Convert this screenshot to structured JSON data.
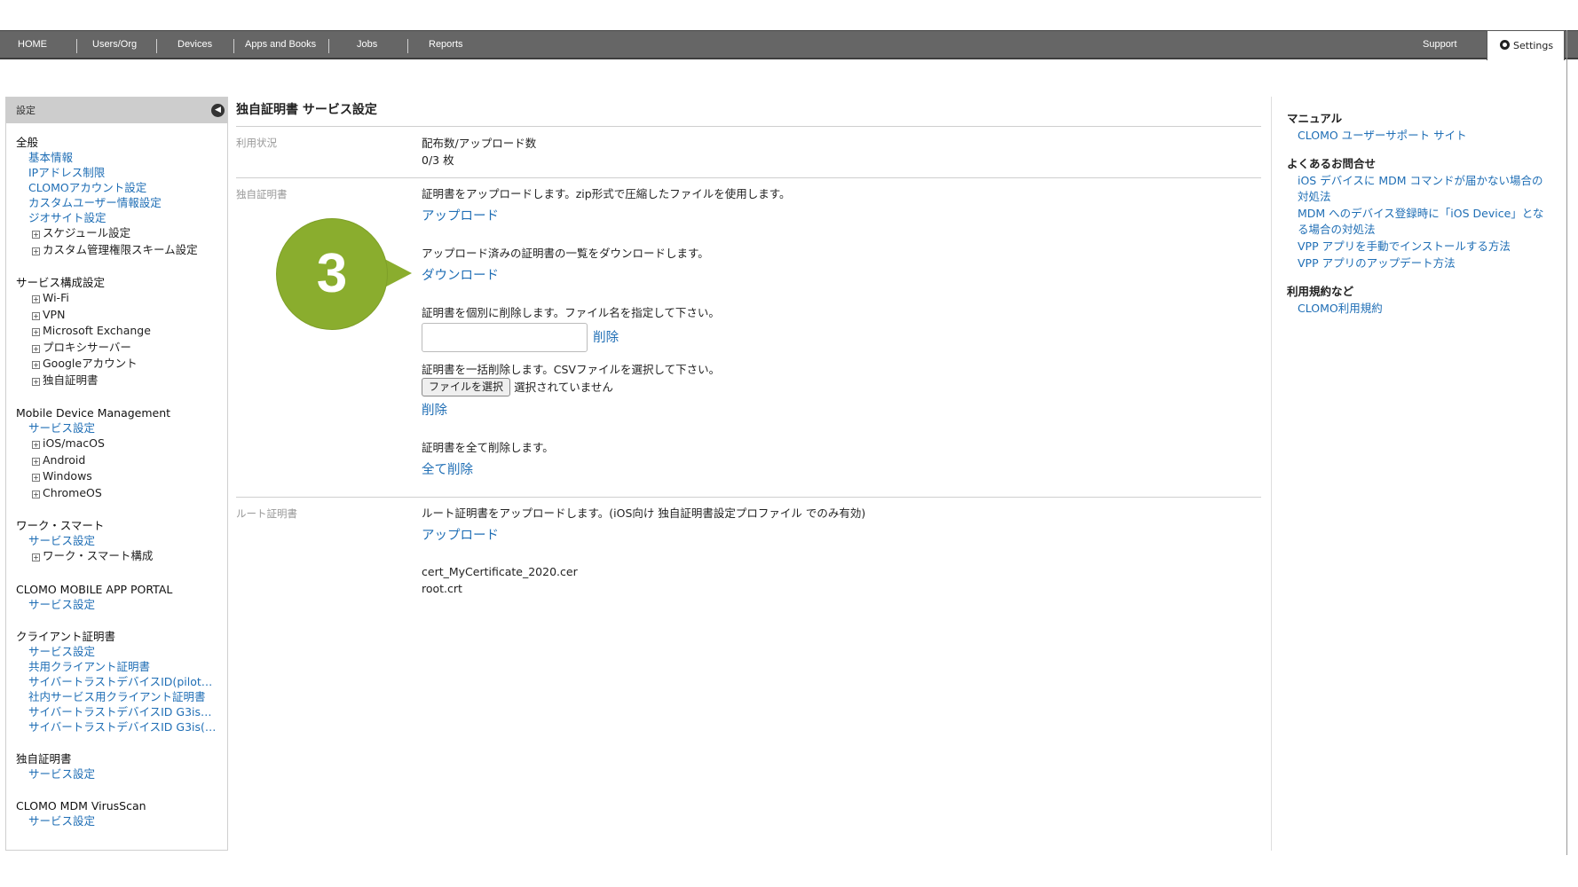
{
  "nav": {
    "items": [
      "HOME",
      "Users/Org",
      "Devices",
      "Apps and Books",
      "Jobs",
      "Reports"
    ],
    "support": "Support",
    "settings": "Settings"
  },
  "sidebar": {
    "header": "設定",
    "groups": [
      {
        "title": "全般",
        "links": [
          "基本情報",
          "IPアドレス制限",
          "CLOMOアカウント設定",
          "カスタムユーザー情報設定",
          "ジオサイト設定"
        ],
        "tree": [
          "スケジュール設定",
          "カスタム管理権限スキーム設定"
        ]
      },
      {
        "title": "サービス構成設定",
        "links": [],
        "tree": [
          "Wi-Fi",
          "VPN",
          "Microsoft Exchange",
          "プロキシサーバー",
          "Googleアカウント",
          "独自証明書"
        ]
      },
      {
        "title": "Mobile Device Management",
        "links": [
          "サービス設定"
        ],
        "tree": [
          "iOS/macOS",
          "Android",
          "Windows",
          "ChromeOS"
        ]
      },
      {
        "title": "ワーク・スマート",
        "links": [
          "サービス設定"
        ],
        "tree": [
          "ワーク・スマート構成"
        ]
      },
      {
        "title": "CLOMO MOBILE APP PORTAL",
        "links": [
          "サービス設定"
        ],
        "tree": []
      },
      {
        "title": "クライアント証明書",
        "links": [
          "サービス設定",
          "共用クライアント証明書",
          "サイバートラストデバイスID(pilot)…",
          "社内サービス用クライアント証明書",
          "サイバートラストデバイスID G3is…",
          "サイバートラストデバイスID G3is(…"
        ],
        "tree": []
      },
      {
        "title": "独自証明書",
        "links": [
          "サービス設定"
        ],
        "tree": []
      },
      {
        "title": "CLOMO MDM VirusScan",
        "links": [
          "サービス設定"
        ],
        "tree": []
      }
    ]
  },
  "main": {
    "title": "独自証明書 サービス設定",
    "usage": {
      "label": "利用状況",
      "heading": "配布数/アップロード数",
      "value": "0/3 枚"
    },
    "cert": {
      "label": "独自証明書",
      "upload_desc": "証明書をアップロードします。zip形式で圧縮したファイルを使用します。",
      "upload_link": "アップロード",
      "download_desc": "アップロード済みの証明書の一覧をダウンロードします。",
      "download_link": "ダウンロード",
      "delete_one_desc": "証明書を個別に削除します。ファイル名を指定して下さい。",
      "delete_one_link": "削除",
      "bulk_desc": "証明書を一括削除します。CSVファイルを選択して下さい。",
      "file_button": "ファイルを選択",
      "file_status": "選択されていません",
      "bulk_link": "削除",
      "delete_all_desc": "証明書を全て削除します。",
      "delete_all_link": "全て削除"
    },
    "root": {
      "label": "ルート証明書",
      "desc": "ルート証明書をアップロードします。(iOS向け 独自証明書設定プロファイル でのみ有効)",
      "upload_link": "アップロード",
      "files": [
        "cert_MyCertificate_2020.cer",
        "root.crt"
      ]
    }
  },
  "step_badge": "3",
  "right": {
    "groups": [
      {
        "title": "マニュアル",
        "links": [
          "CLOMO ユーザーサポート サイト"
        ]
      },
      {
        "title": "よくあるお問合せ",
        "links": [
          "iOS デバイスに MDM コマンドが届かない場合の対処法",
          "MDM へのデバイス登録時に「iOS Device」となる場合の対処法",
          "VPP アプリを手動でインストールする方法",
          "VPP アプリのアップデート方法"
        ]
      },
      {
        "title": "利用規約など",
        "links": [
          "CLOMO利用規約"
        ]
      }
    ]
  },
  "colors": {
    "nav_bg": "#666666",
    "link": "#1f6eb5",
    "badge": "#8aad2e"
  }
}
